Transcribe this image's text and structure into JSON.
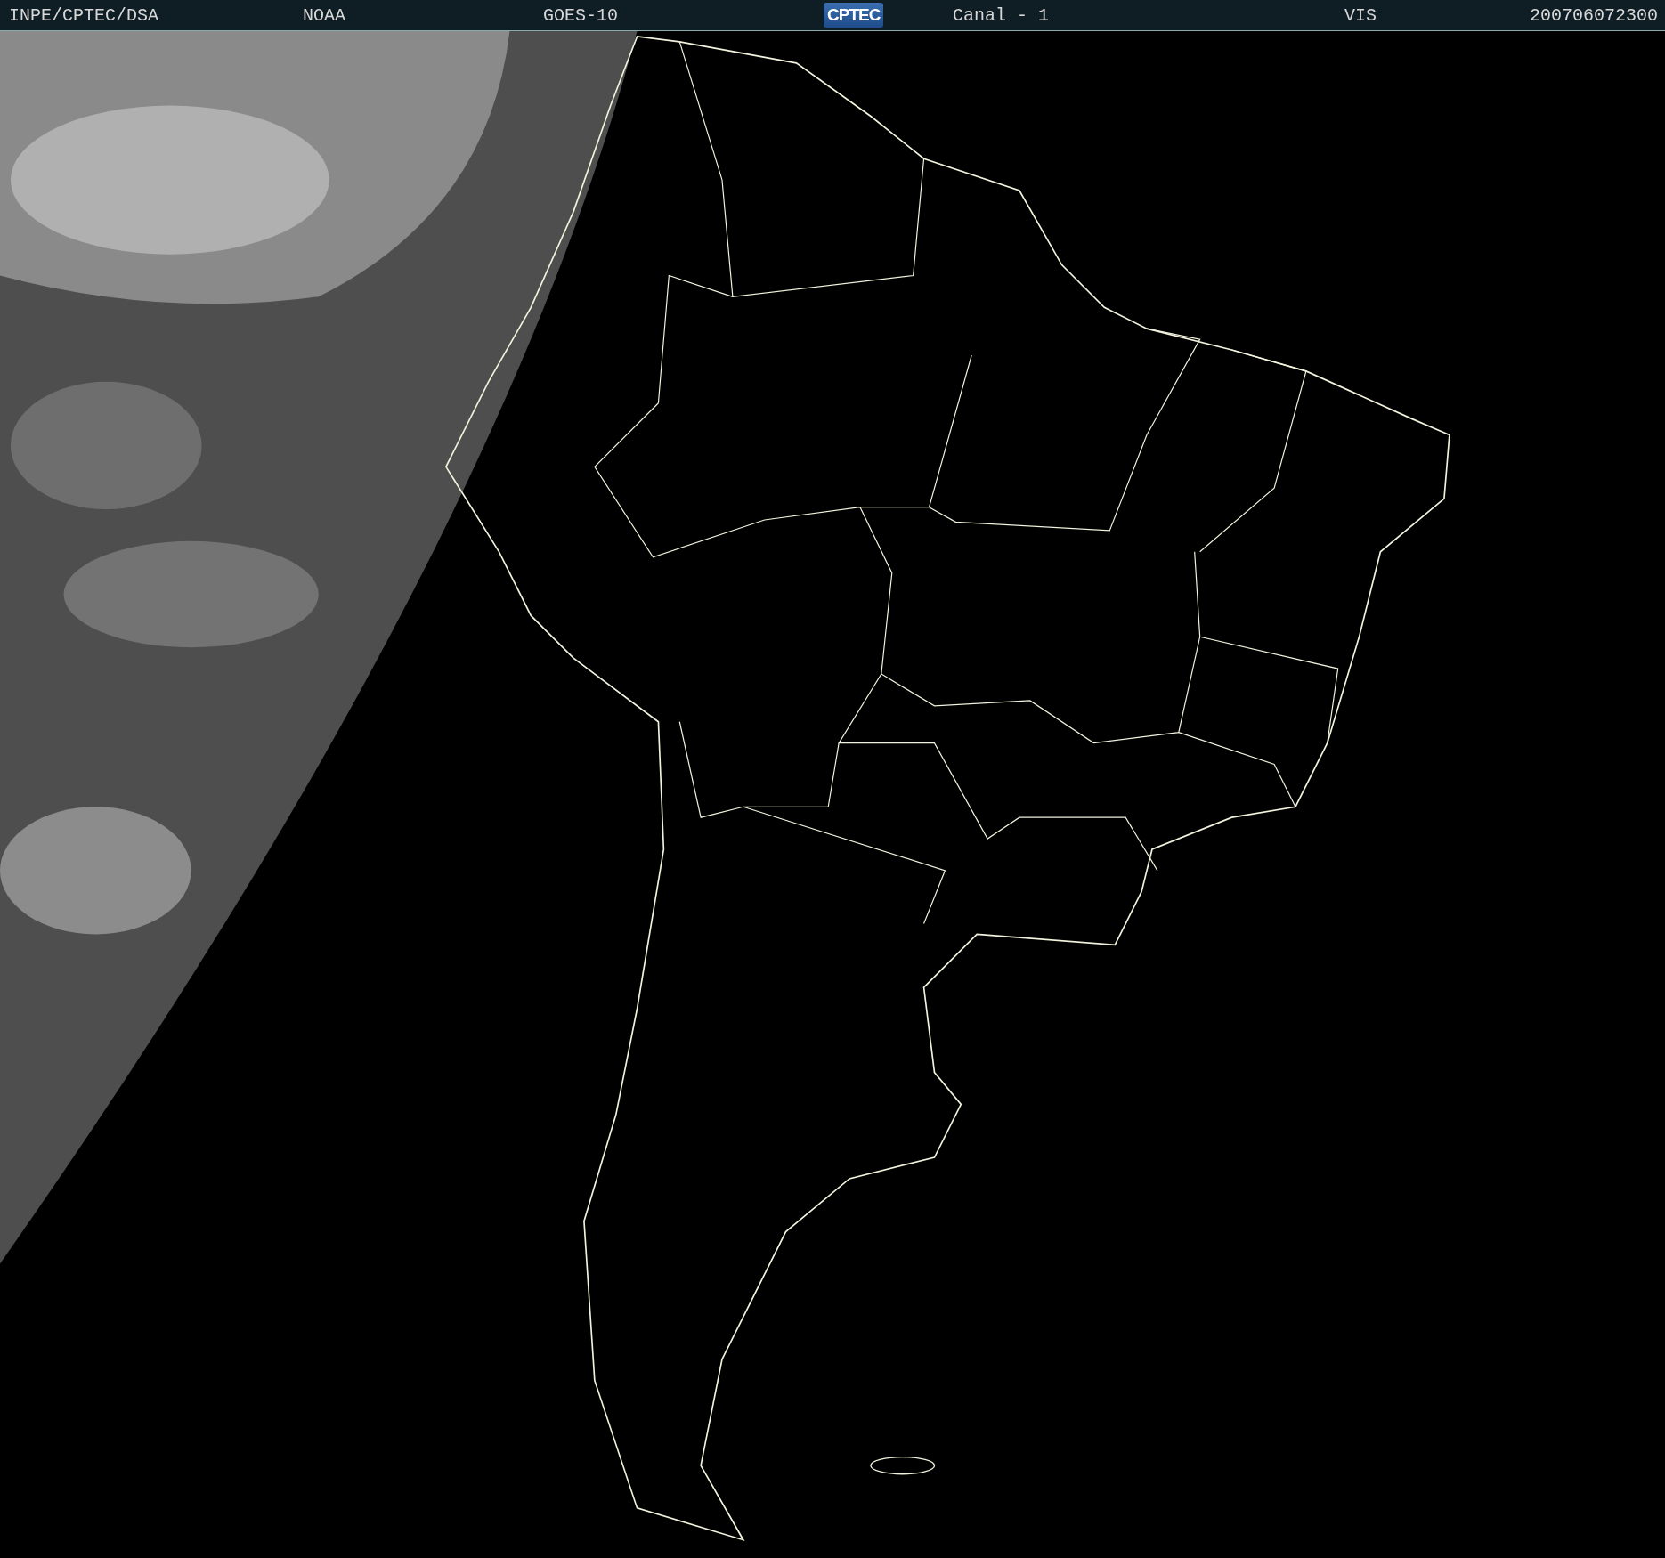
{
  "header": {
    "items": [
      {
        "kind": "text",
        "text": "INPE/CPTEC/DSA"
      },
      {
        "kind": "text",
        "text": "NOAA"
      },
      {
        "kind": "text",
        "text": "GOES-10"
      },
      {
        "kind": "logo",
        "text": "CPTEC"
      },
      {
        "kind": "text",
        "text": "Canal - 1"
      },
      {
        "kind": "text",
        "text": "VIS"
      },
      {
        "kind": "text",
        "text": "200706072300"
      }
    ]
  }
}
